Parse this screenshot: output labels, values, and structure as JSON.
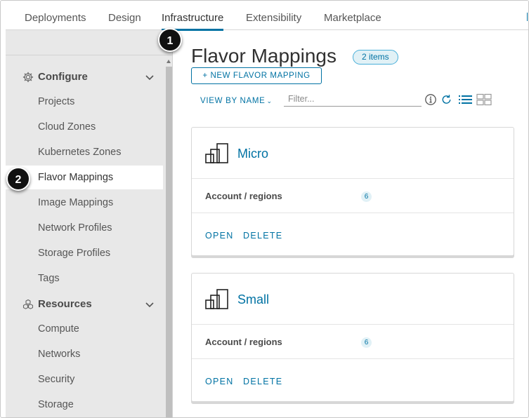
{
  "nav": {
    "tabs": [
      {
        "label": "Deployments"
      },
      {
        "label": "Design"
      },
      {
        "label": "Infrastructure"
      },
      {
        "label": "Extensibility"
      },
      {
        "label": "Marketplace"
      }
    ],
    "active_tab": "Infrastructure"
  },
  "sidebar": {
    "configure": {
      "label": "Configure",
      "icon": "gear-icon",
      "items": [
        {
          "label": "Projects"
        },
        {
          "label": "Cloud Zones"
        },
        {
          "label": "Kubernetes Zones"
        },
        {
          "label": "Flavor Mappings"
        },
        {
          "label": "Image Mappings"
        },
        {
          "label": "Network Profiles"
        },
        {
          "label": "Storage Profiles"
        },
        {
          "label": "Tags"
        }
      ]
    },
    "resources": {
      "label": "Resources",
      "icon": "resources-icon",
      "items": [
        {
          "label": "Compute"
        },
        {
          "label": "Networks"
        },
        {
          "label": "Security"
        },
        {
          "label": "Storage"
        }
      ]
    },
    "active_item": "Flavor Mappings"
  },
  "callouts": [
    "1",
    "2"
  ],
  "main": {
    "title": "Flavor Mappings",
    "count_badge": "2 items",
    "new_button": "+ NEW FLAVOR MAPPING",
    "view_by": "VIEW BY NAME",
    "filter_placeholder": "Filter...",
    "filter_value": "",
    "toolbar_icons": [
      "info-icon",
      "refresh-icon",
      "list-view-icon",
      "grid-view-icon"
    ],
    "cards": [
      {
        "name": "Micro",
        "row_label": "Account / regions",
        "row_count": "6",
        "actions": [
          "OPEN",
          "DELETE"
        ]
      },
      {
        "name": "Small",
        "row_label": "Account / regions",
        "row_count": "6",
        "actions": [
          "OPEN",
          "DELETE"
        ]
      }
    ]
  },
  "colors": {
    "accent": "#0072a3",
    "sidebar_bg": "#e8e8e8",
    "badge_bg": "#e1f1f6",
    "callout_bg": "#111111"
  }
}
